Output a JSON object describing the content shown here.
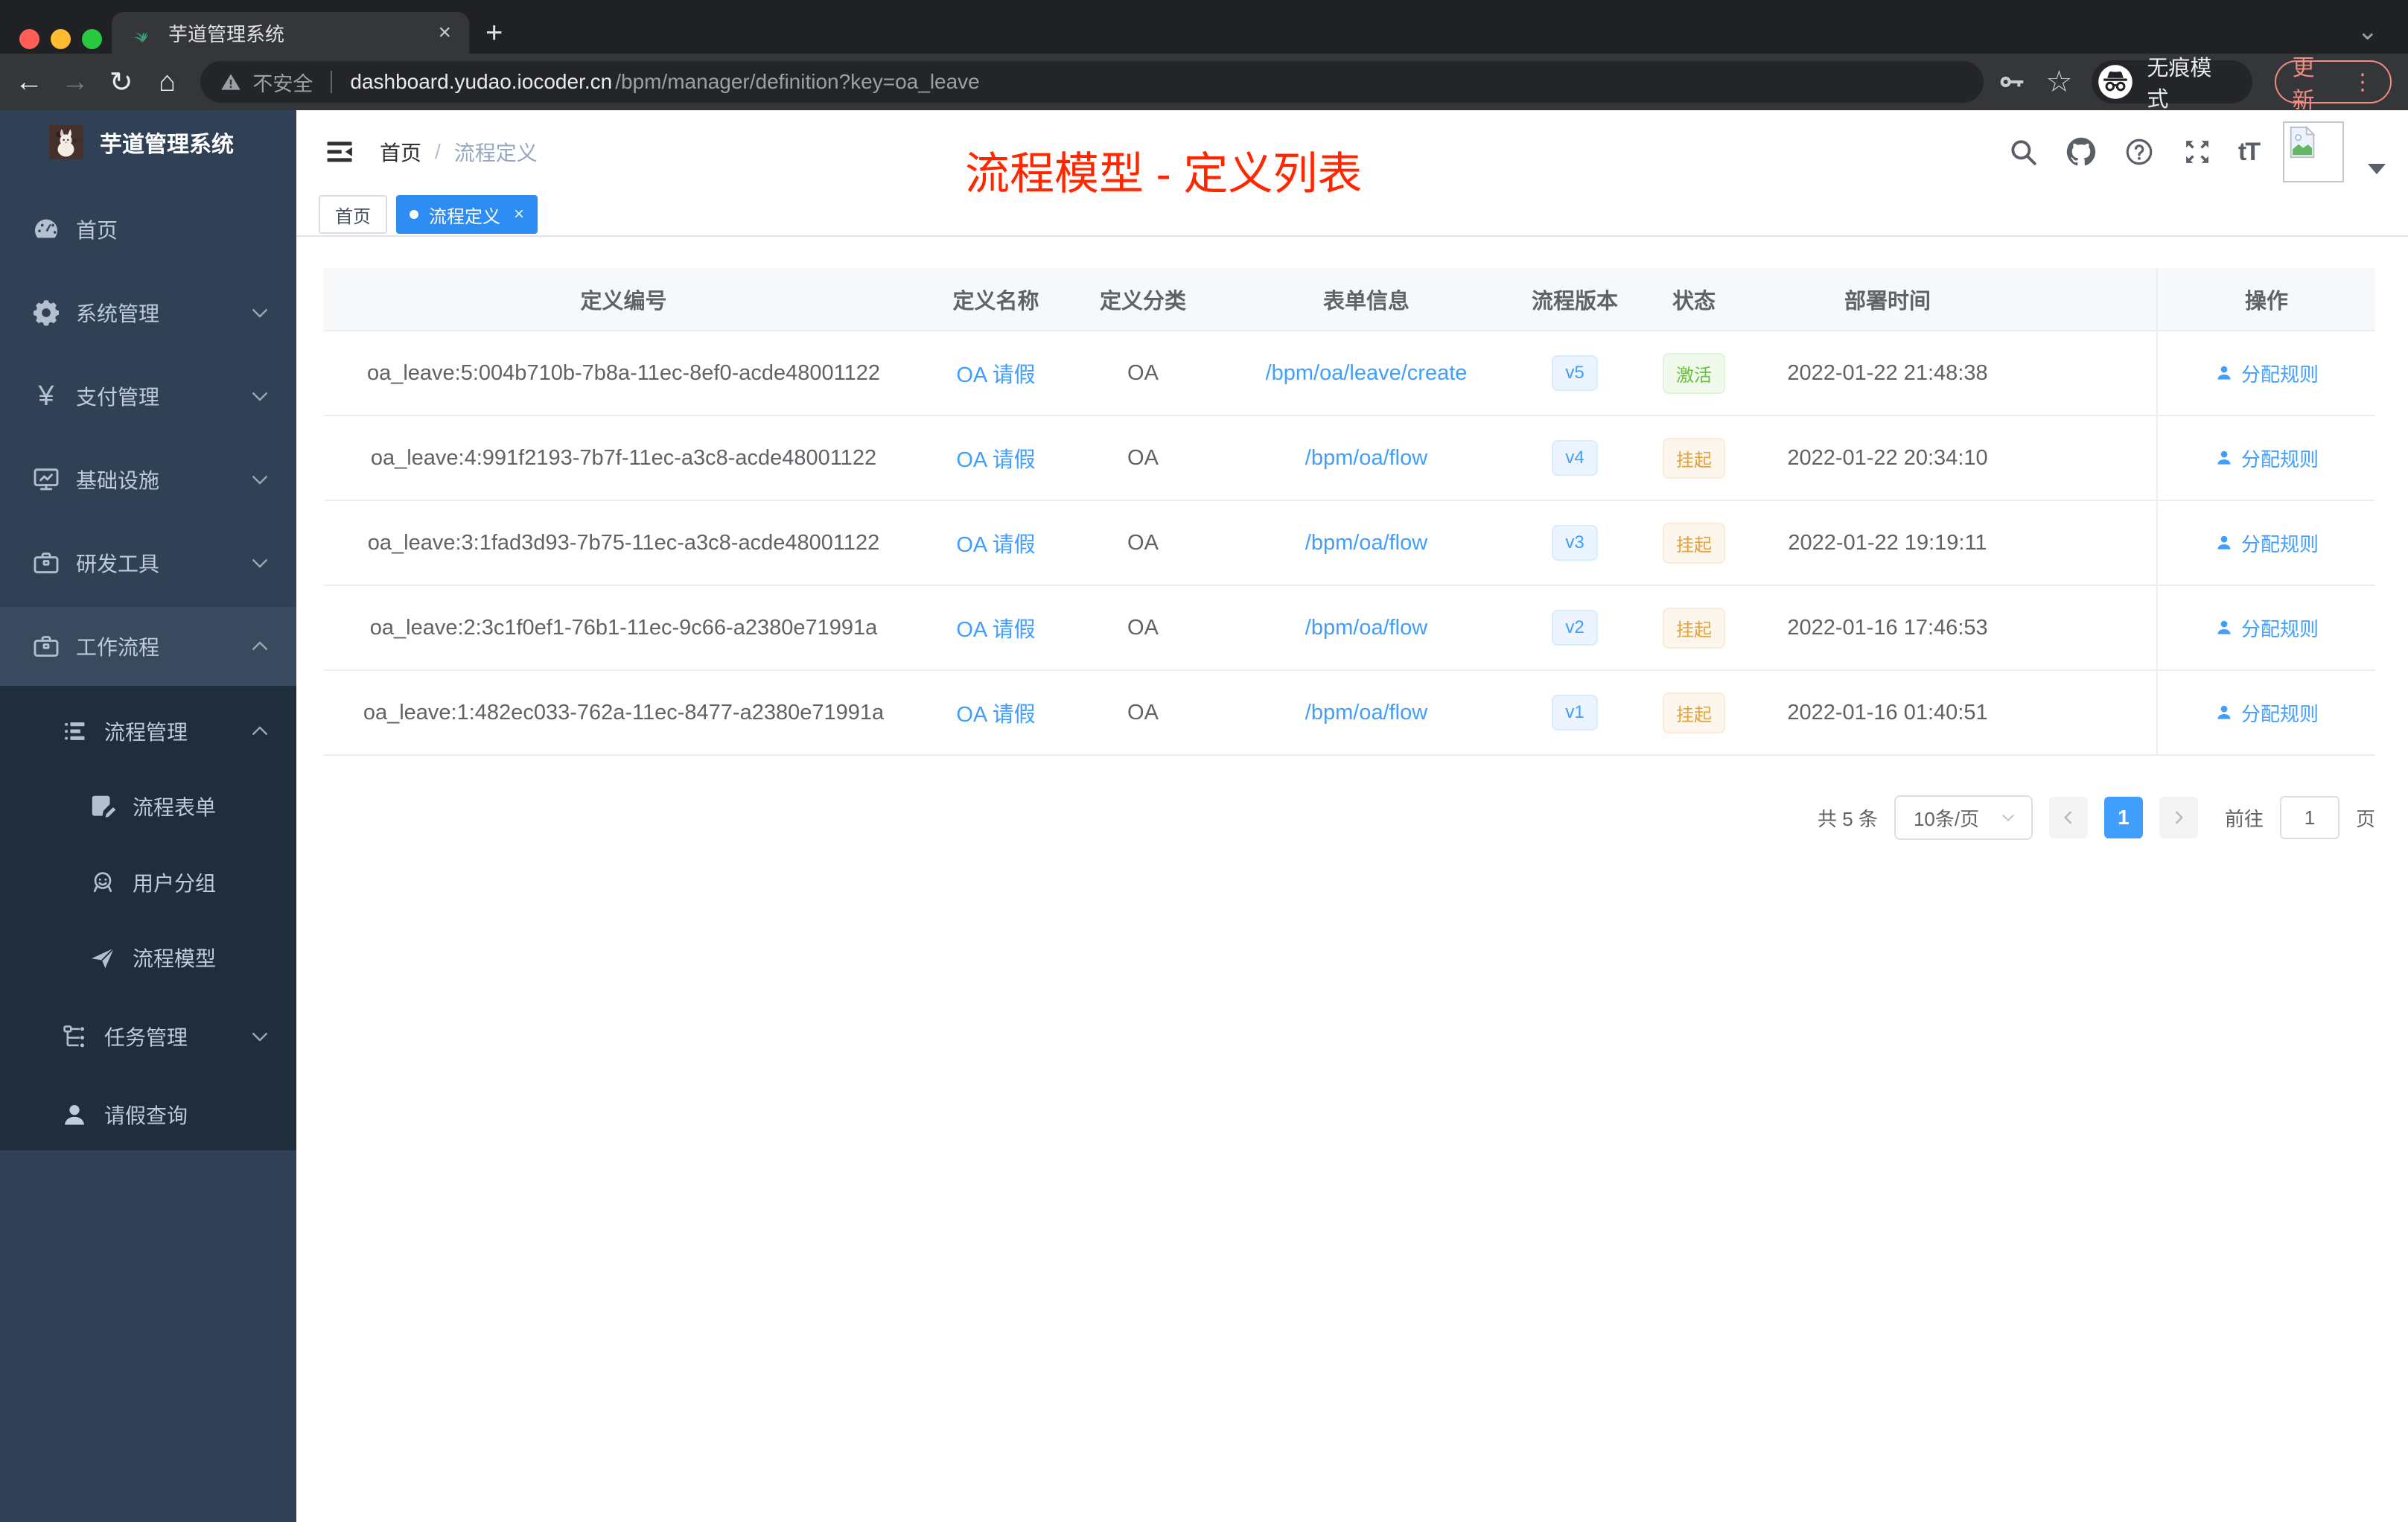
{
  "browser": {
    "tab_title": "芋道管理系统",
    "new_tab_glyph": "+",
    "tab_close_glyph": "×",
    "strip_caret_glyph": "⌄",
    "back_glyph": "←",
    "forward_glyph": "→",
    "reload_glyph": "↻",
    "home_glyph": "⌂",
    "url_security": "不安全",
    "url_host": "dashboard.yudao.iocoder.cn",
    "url_path": "/bpm/manager/definition?key=oa_leave",
    "star_glyph": "☆",
    "incognito_label": "无痕模式",
    "update_label": "更新",
    "menu_dots_glyph": "⋮"
  },
  "sidebar": {
    "app_title": "芋道管理系统",
    "items": [
      {
        "label": "首页"
      },
      {
        "label": "系统管理"
      },
      {
        "label": "支付管理"
      },
      {
        "label": "基础设施"
      },
      {
        "label": "研发工具"
      },
      {
        "label": "工作流程"
      },
      {
        "label": "流程管理"
      },
      {
        "label": "流程表单"
      },
      {
        "label": "用户分组"
      },
      {
        "label": "流程模型"
      },
      {
        "label": "任务管理"
      },
      {
        "label": "请假查询"
      }
    ],
    "yen_glyph": "¥"
  },
  "header": {
    "breadcrumb": {
      "home": "首页",
      "separator": "/",
      "current": "流程定义"
    },
    "annotation": "流程模型 - 定义列表",
    "font_size_glyph": "tT",
    "help_glyph": "?"
  },
  "tags": {
    "home": "首页",
    "active": "流程定义",
    "close_glyph": "×"
  },
  "table": {
    "columns": [
      "定义编号",
      "定义名称",
      "定义分类",
      "表单信息",
      "流程版本",
      "状态",
      "部署时间",
      "操作"
    ],
    "rows": [
      {
        "id": "oa_leave:5:004b710b-7b8a-11ec-8ef0-acde48001122",
        "name": "OA 请假",
        "category": "OA",
        "form": "/bpm/oa/leave/create",
        "version": "v5",
        "status": "激活",
        "status_type": "active",
        "deploy_time": "2022-01-22 21:48:38",
        "action": "分配规则"
      },
      {
        "id": "oa_leave:4:991f2193-7b7f-11ec-a3c8-acde48001122",
        "name": "OA 请假",
        "category": "OA",
        "form": "/bpm/oa/flow",
        "version": "v4",
        "status": "挂起",
        "status_type": "suspended",
        "deploy_time": "2022-01-22 20:34:10",
        "action": "分配规则"
      },
      {
        "id": "oa_leave:3:1fad3d93-7b75-11ec-a3c8-acde48001122",
        "name": "OA 请假",
        "category": "OA",
        "form": "/bpm/oa/flow",
        "version": "v3",
        "status": "挂起",
        "status_type": "suspended",
        "deploy_time": "2022-01-22 19:19:11",
        "action": "分配规则"
      },
      {
        "id": "oa_leave:2:3c1f0ef1-76b1-11ec-9c66-a2380e71991a",
        "name": "OA 请假",
        "category": "OA",
        "form": "/bpm/oa/flow",
        "version": "v2",
        "status": "挂起",
        "status_type": "suspended",
        "deploy_time": "2022-01-16 17:46:53",
        "action": "分配规则"
      },
      {
        "id": "oa_leave:1:482ec033-762a-11ec-8477-a2380e71991a",
        "name": "OA 请假",
        "category": "OA",
        "form": "/bpm/oa/flow",
        "version": "v1",
        "status": "挂起",
        "status_type": "suspended",
        "deploy_time": "2022-01-16 01:40:51",
        "action": "分配规则"
      }
    ]
  },
  "pagination": {
    "total": "共 5 条",
    "page_size": "10条/页",
    "prev_glyph": "‹",
    "next_glyph": "›",
    "current_page": "1",
    "goto_label": "前往",
    "goto_value": "1",
    "page_unit": "页"
  },
  "colors": {
    "accent_blue": "#409eff",
    "active_tag_blue": "#2d8df2",
    "sidebar_bg": "#304156",
    "submenu_bg": "#1f2d3d",
    "status_active_green": "#67c23a",
    "status_suspended_orange": "#e6a23c",
    "annotation_red": "#ff2600",
    "update_coral": "#f28b82"
  }
}
